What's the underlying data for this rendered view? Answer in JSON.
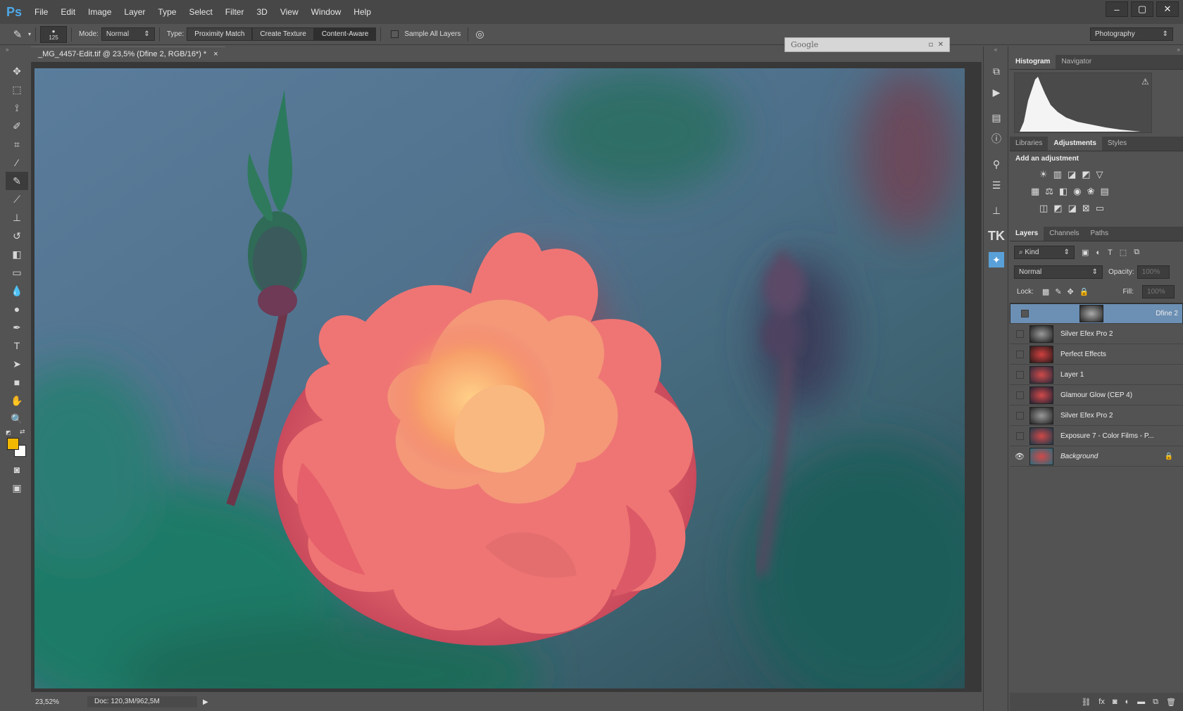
{
  "app": {
    "logo": "Ps",
    "menu": [
      "File",
      "Edit",
      "Image",
      "Layer",
      "Type",
      "Select",
      "Filter",
      "3D",
      "View",
      "Window",
      "Help"
    ],
    "window_controls": [
      "–",
      "▢",
      "✕"
    ]
  },
  "options": {
    "brush_size": "125",
    "mode_label": "Mode:",
    "mode_value": "Normal",
    "type_label": "Type:",
    "type_buttons": [
      "Proximity Match",
      "Create Texture",
      "Content-Aware"
    ],
    "sample_all_layers": "Sample All Layers",
    "workspace": "Photography"
  },
  "document": {
    "tab_title": "_MG_4457-Edit.tif @ 23,5% (Dfine 2, RGB/16*) *",
    "close": "×",
    "zoom": "23,52%",
    "doc_size": "Doc: 120,3M/962,5M"
  },
  "google_window": {
    "title": "Google"
  },
  "panels": {
    "top_tabs": [
      "Histogram",
      "Navigator"
    ],
    "mid_tabs": [
      "Libraries",
      "Adjustments",
      "Styles"
    ],
    "add_adjustment": "Add an adjustment",
    "layer_tabs": [
      "Layers",
      "Channels",
      "Paths"
    ],
    "kind": "Kind",
    "blend": "Normal",
    "opacity_label": "Opacity:",
    "opacity": "100%",
    "lock_label": "Lock:",
    "fill_label": "Fill:",
    "fill": "100%",
    "layers": [
      {
        "name": "Dfine 2",
        "visible": false,
        "selected": true
      },
      {
        "name": "Silver Efex Pro 2",
        "visible": false,
        "selected": false
      },
      {
        "name": "Perfect Effects",
        "visible": false,
        "selected": false
      },
      {
        "name": "Layer 1",
        "visible": false,
        "selected": false
      },
      {
        "name": "Glamour Glow (CEP 4)",
        "visible": false,
        "selected": false
      },
      {
        "name": "Silver Efex Pro 2",
        "visible": false,
        "selected": false
      },
      {
        "name": "Exposure 7 - Color Films - P...",
        "visible": false,
        "selected": false
      },
      {
        "name": "Background",
        "visible": true,
        "selected": false,
        "locked": true
      }
    ]
  },
  "colors": {
    "foreground": "#f2b800",
    "background": "#ffffff",
    "selection": "#6c8fb4"
  }
}
